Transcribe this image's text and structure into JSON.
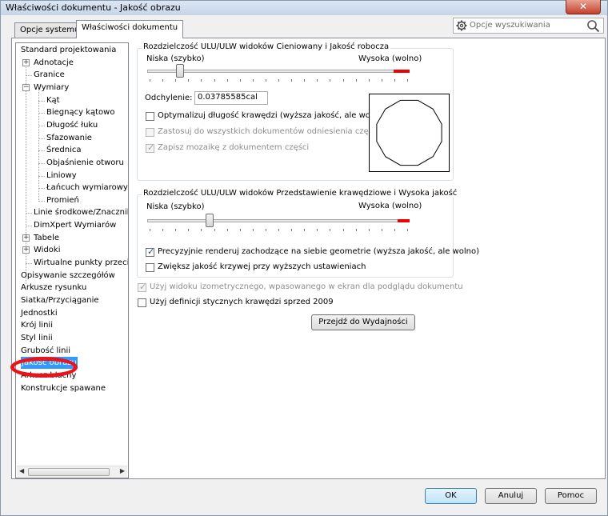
{
  "window": {
    "title": "Właściwości dokumentu - Jakość obrazu",
    "close_symbol": "✕"
  },
  "tabs": [
    {
      "label": "Opcje systemu",
      "active": false
    },
    {
      "label": "Właściwości dokumentu",
      "active": true
    }
  ],
  "search": {
    "placeholder": "Opcje wyszukiwania",
    "icon": "magnifier-icon"
  },
  "tree": {
    "items": [
      {
        "label": "Standard projektowania",
        "level": 0
      },
      {
        "label": "Adnotacje",
        "level": 1,
        "expander": "+"
      },
      {
        "label": "Granice",
        "level": 1
      },
      {
        "label": "Wymiary",
        "level": 1,
        "expander": "−"
      },
      {
        "label": "Kąt",
        "level": 2
      },
      {
        "label": "Biegnący kątowo",
        "level": 2
      },
      {
        "label": "Długość łuku",
        "level": 2
      },
      {
        "label": "Sfazowanie",
        "level": 2
      },
      {
        "label": "Średnica",
        "level": 2
      },
      {
        "label": "Objaśnienie otworu",
        "level": 2
      },
      {
        "label": "Liniowy",
        "level": 2
      },
      {
        "label": "Łańcuch wymiarowy",
        "level": 2
      },
      {
        "label": "Promień",
        "level": 2
      },
      {
        "label": "Linie środkowe/Znaczniki",
        "level": 1
      },
      {
        "label": "DimXpert Wymiarów",
        "level": 1
      },
      {
        "label": "Tabele",
        "level": 1,
        "expander": "+"
      },
      {
        "label": "Widoki",
        "level": 1,
        "expander": "+"
      },
      {
        "label": "Wirtualne punkty przecięcia",
        "level": 1
      },
      {
        "label": "Opisywanie szczegółów",
        "level": 0
      },
      {
        "label": "Arkusze rysunku",
        "level": 0
      },
      {
        "label": "Siatka/Przyciąganie",
        "level": 0
      },
      {
        "label": "Jednostki",
        "level": 0
      },
      {
        "label": "Krój linii",
        "level": 0
      },
      {
        "label": "Styl linii",
        "level": 0
      },
      {
        "label": "Grubość linii",
        "level": 0
      },
      {
        "label": "Jakość obrazu",
        "level": 0,
        "selected": true
      },
      {
        "label": "Arkusz blachy",
        "level": 0
      },
      {
        "label": "Konstrukcje spawane",
        "level": 0
      }
    ],
    "scroll_left": "◀",
    "scroll_right": "▶"
  },
  "group_shaded": {
    "title": "Rozdzielczość ULU/ULW widoków Cieniowany i Jakość robocza",
    "low_label": "Niska (szybko)",
    "high_label": "Wysoka (wolno)",
    "slider_value": 0.2,
    "deviation_label": "Odchylenie:",
    "deviation_value": "0.03785585cal",
    "checkboxes": [
      {
        "label": "Optymalizuj długość krawędzi (wyższa jakość, ale wolno)",
        "checked": false,
        "disabled": false
      },
      {
        "label": "Zastosuj do wszystkich dokumentów odniesienia części",
        "checked": false,
        "disabled": true
      },
      {
        "label": "Zapisz mozaikę z dokumentem części",
        "checked": true,
        "disabled": true
      }
    ]
  },
  "group_wireframe": {
    "title": "Rozdzielczość ULU/ULW widoków Przedstawienie krawędziowe i Wysoka jakość",
    "low_label": "Niska (szybko)",
    "high_label": "Wysoka (wolno)",
    "slider_value": 0.25,
    "checkboxes": [
      {
        "label": "Precyzyjnie renderuj zachodzące na siebie geometrie (wyższa jakość, ale wolno)",
        "checked": true,
        "disabled": false
      },
      {
        "label": "Zwiększ jakość krzywej przy wyższych ustawieniach",
        "checked": false,
        "disabled": false
      }
    ]
  },
  "options": [
    {
      "label": "Użyj widoku izometrycznego, wpasowanego w ekran dla podglądu dokumentu",
      "checked": true,
      "disabled": true
    },
    {
      "label": "Użyj definicji stycznych krawędzi sprzed 2009",
      "checked": false,
      "disabled": false
    }
  ],
  "buttons": {
    "performance": "Przejdź do Wydajności",
    "ok": "OK",
    "cancel": "Anuluj",
    "help": "Pomoc"
  },
  "colors": {
    "selection": "#3399ff",
    "slider_max": "#e00000",
    "annotation": "#e8141a"
  }
}
